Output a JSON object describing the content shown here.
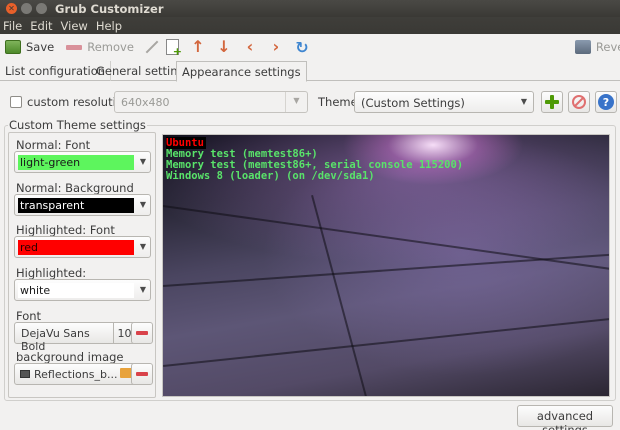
{
  "window": {
    "title": "Grub Customizer"
  },
  "menubar": {
    "items": [
      "File",
      "Edit",
      "View",
      "Help"
    ]
  },
  "toolbar": {
    "save_label": "Save",
    "remove_label": "Remove",
    "revert_label": "Revert",
    "icons": [
      "save-icon",
      "remove-icon",
      "edit-icon",
      "new-entry-icon",
      "move-up-icon",
      "move-down-icon",
      "move-left-icon",
      "move-right-icon",
      "refresh-icon",
      "revert-icon"
    ]
  },
  "tabs": [
    {
      "label": "List configuration",
      "active": false
    },
    {
      "label": "General settings",
      "active": false
    },
    {
      "label": "Appearance settings",
      "active": true
    }
  ],
  "resolution": {
    "label": "custom resolution:",
    "checked": false,
    "value": "640x480"
  },
  "theme": {
    "label": "Theme:",
    "value": "(Custom Settings)"
  },
  "frame": {
    "title": "Custom Theme settings"
  },
  "settings": {
    "normal_font": {
      "label": "Normal: Font",
      "value": "light-green",
      "color": "#5df55d"
    },
    "normal_background": {
      "label": "Normal: Background",
      "value": "transparent",
      "color": "#000000"
    },
    "highlighted_font": {
      "label": "Highlighted: Font",
      "value": "red",
      "color": "#ff0000"
    },
    "highlighted_background": {
      "label": "Highlighted: Background",
      "value": "white",
      "color": "#ffffff"
    },
    "font": {
      "label": "Font",
      "name": "DejaVu Sans Bold",
      "size": "10"
    },
    "background_image": {
      "label": "background image",
      "value": "Reflections_b..."
    }
  },
  "preview": {
    "entries": [
      "Ubuntu",
      "Memory test (memtest86+)",
      "Memory test (memtest86+, serial console 115200)",
      "Windows 8 (loader) (on /dev/sda1)"
    ]
  },
  "advanced_button": "advanced settings"
}
